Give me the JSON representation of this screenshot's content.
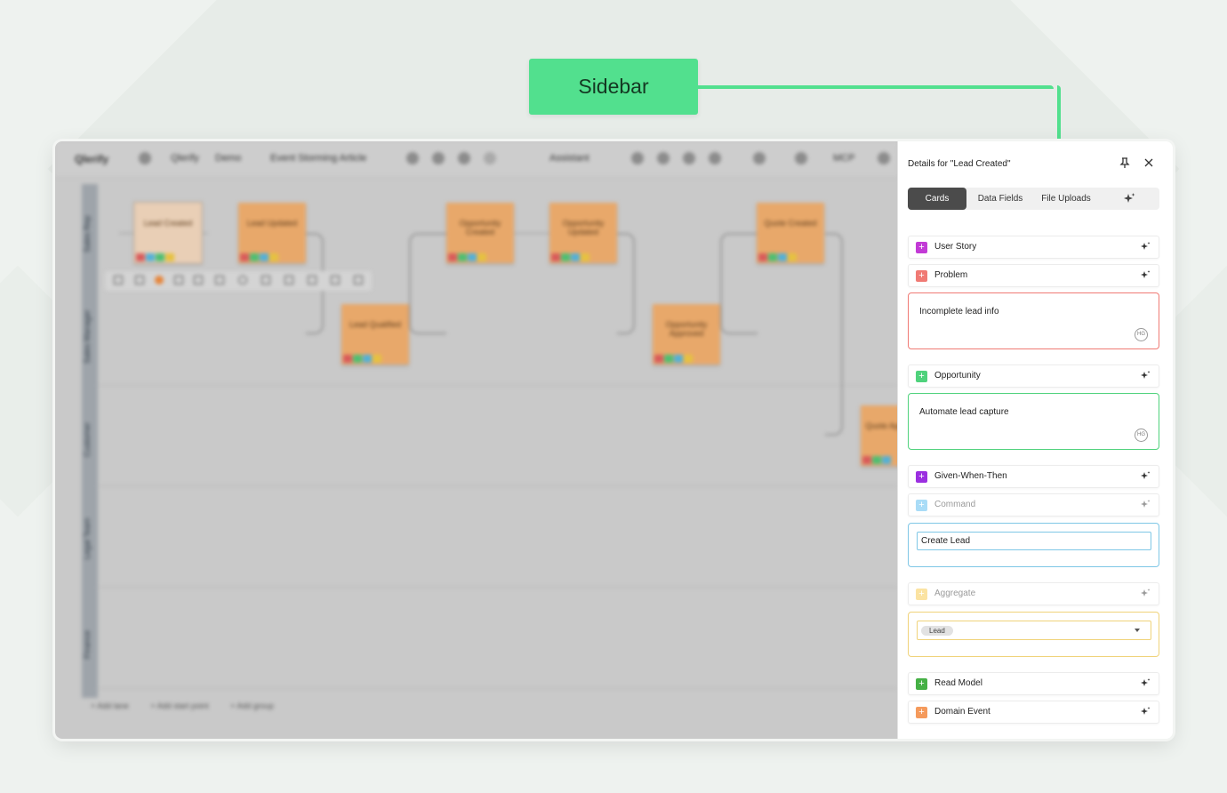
{
  "callout": {
    "label": "Sidebar"
  },
  "toolbar": {
    "logo": "Qlerify",
    "breadcrumb": [
      "Qlerify",
      "Demo",
      "Event Storming Article"
    ],
    "assistant": "Assistant",
    "mcp": "MCP"
  },
  "lanes": [
    "Sales Rep",
    "Sales Manager",
    "Customer",
    "Legal Team",
    "Finance"
  ],
  "stickies": [
    "Lead Created",
    "Lead Updated",
    "Lead Qualified",
    "Opportunity Created",
    "Opportunity Updated",
    "Opportunity Approved",
    "Quote Created",
    "Quote Approved"
  ],
  "add_links": [
    "+ Add lane",
    "+ Add start point",
    "+ Add group"
  ],
  "sidebar": {
    "title": "Details for \"Lead Created\"",
    "tabs": [
      "Cards",
      "Data Fields",
      "File Uploads"
    ],
    "cards": {
      "user_story": "User Story",
      "problem": "Problem",
      "problem_text": "Incomplete lead info",
      "opportunity": "Opportunity",
      "opportunity_text": "Automate lead capture",
      "gwt": "Given-When-Then",
      "command": "Command",
      "command_value": "Create Lead",
      "aggregate": "Aggregate",
      "aggregate_value": "Lead",
      "read_model": "Read Model",
      "domain_event": "Domain Event"
    },
    "hg_badge": "HG",
    "colors": {
      "user_story": "#c23ad6",
      "problem": "#f07a74",
      "opportunity": "#4fd27c",
      "gwt": "#9b2fe0",
      "command": "#a9dcf7",
      "aggregate": "#fbe3a2",
      "read_model": "#45b045",
      "domain_event": "#f59a5c"
    }
  }
}
